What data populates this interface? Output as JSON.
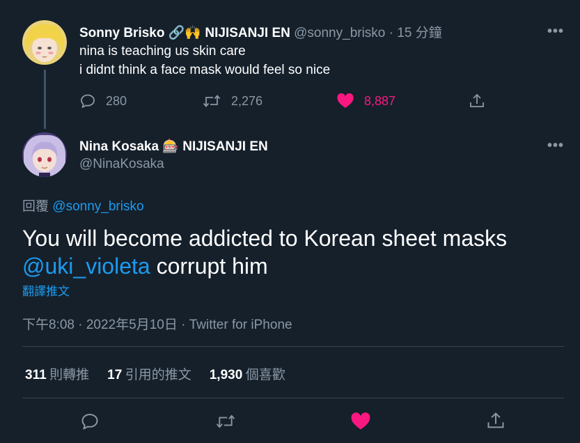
{
  "parent_tweet": {
    "display_name": "Sonny Brisko",
    "name_emoji": "🔗🙌",
    "affiliation": "NIJISANJI EN",
    "handle": "@sonny_brisko",
    "separator": "·",
    "time_ago": "15 分鐘",
    "more": "•••",
    "lines": [
      "nina is teaching us skin care",
      "i didnt think a face mask would feel so nice"
    ],
    "actions": {
      "reply_count": "280",
      "retweet_count": "2,276",
      "like_count": "8,887"
    }
  },
  "main_tweet": {
    "display_name": "Nina Kosaka",
    "name_emoji": "🎰",
    "affiliation": "NIJISANJI EN",
    "handle": "@NinaKosaka",
    "more": "•••",
    "reply_to_prefix": "回覆",
    "reply_to_handle": "@sonny_brisko",
    "text_line1": "You will become addicted to Korean sheet masks",
    "mention": "@uki_violeta",
    "text_line2_rest": " corrupt him",
    "translate_label": "翻譯推文",
    "timestamp": "下午8:08 · 2022年5月10日",
    "source_separator": " · ",
    "source": "Twitter for iPhone",
    "stats": {
      "retweets_value": "311",
      "retweets_label": "則轉推",
      "quotes_value": "17",
      "quotes_label": "引用的推文",
      "likes_value": "1,930",
      "likes_label": "個喜歡"
    }
  },
  "colors": {
    "background": "#15202b",
    "text": "#ffffff",
    "muted": "#8b98a5",
    "link": "#1d9bf0",
    "like": "#f91880",
    "divider": "#38444d"
  },
  "icons": [
    "reply-icon",
    "retweet-icon",
    "like-icon",
    "share-icon",
    "more-icon"
  ]
}
